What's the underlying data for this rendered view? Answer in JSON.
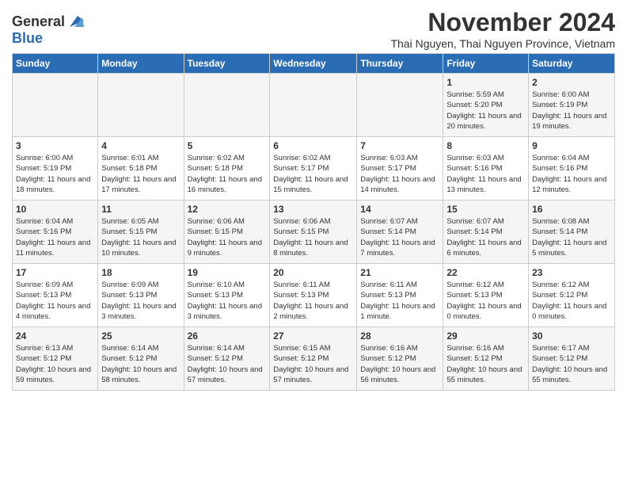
{
  "header": {
    "logo_general": "General",
    "logo_blue": "Blue",
    "month_year": "November 2024",
    "location": "Thai Nguyen, Thai Nguyen Province, Vietnam"
  },
  "calendar": {
    "days_of_week": [
      "Sunday",
      "Monday",
      "Tuesday",
      "Wednesday",
      "Thursday",
      "Friday",
      "Saturday"
    ],
    "weeks": [
      [
        {
          "day": "",
          "info": ""
        },
        {
          "day": "",
          "info": ""
        },
        {
          "day": "",
          "info": ""
        },
        {
          "day": "",
          "info": ""
        },
        {
          "day": "",
          "info": ""
        },
        {
          "day": "1",
          "info": "Sunrise: 5:59 AM\nSunset: 5:20 PM\nDaylight: 11 hours and 20 minutes."
        },
        {
          "day": "2",
          "info": "Sunrise: 6:00 AM\nSunset: 5:19 PM\nDaylight: 11 hours and 19 minutes."
        }
      ],
      [
        {
          "day": "3",
          "info": "Sunrise: 6:00 AM\nSunset: 5:19 PM\nDaylight: 11 hours and 18 minutes."
        },
        {
          "day": "4",
          "info": "Sunrise: 6:01 AM\nSunset: 5:18 PM\nDaylight: 11 hours and 17 minutes."
        },
        {
          "day": "5",
          "info": "Sunrise: 6:02 AM\nSunset: 5:18 PM\nDaylight: 11 hours and 16 minutes."
        },
        {
          "day": "6",
          "info": "Sunrise: 6:02 AM\nSunset: 5:17 PM\nDaylight: 11 hours and 15 minutes."
        },
        {
          "day": "7",
          "info": "Sunrise: 6:03 AM\nSunset: 5:17 PM\nDaylight: 11 hours and 14 minutes."
        },
        {
          "day": "8",
          "info": "Sunrise: 6:03 AM\nSunset: 5:16 PM\nDaylight: 11 hours and 13 minutes."
        },
        {
          "day": "9",
          "info": "Sunrise: 6:04 AM\nSunset: 5:16 PM\nDaylight: 11 hours and 12 minutes."
        }
      ],
      [
        {
          "day": "10",
          "info": "Sunrise: 6:04 AM\nSunset: 5:16 PM\nDaylight: 11 hours and 11 minutes."
        },
        {
          "day": "11",
          "info": "Sunrise: 6:05 AM\nSunset: 5:15 PM\nDaylight: 11 hours and 10 minutes."
        },
        {
          "day": "12",
          "info": "Sunrise: 6:06 AM\nSunset: 5:15 PM\nDaylight: 11 hours and 9 minutes."
        },
        {
          "day": "13",
          "info": "Sunrise: 6:06 AM\nSunset: 5:15 PM\nDaylight: 11 hours and 8 minutes."
        },
        {
          "day": "14",
          "info": "Sunrise: 6:07 AM\nSunset: 5:14 PM\nDaylight: 11 hours and 7 minutes."
        },
        {
          "day": "15",
          "info": "Sunrise: 6:07 AM\nSunset: 5:14 PM\nDaylight: 11 hours and 6 minutes."
        },
        {
          "day": "16",
          "info": "Sunrise: 6:08 AM\nSunset: 5:14 PM\nDaylight: 11 hours and 5 minutes."
        }
      ],
      [
        {
          "day": "17",
          "info": "Sunrise: 6:09 AM\nSunset: 5:13 PM\nDaylight: 11 hours and 4 minutes."
        },
        {
          "day": "18",
          "info": "Sunrise: 6:09 AM\nSunset: 5:13 PM\nDaylight: 11 hours and 3 minutes."
        },
        {
          "day": "19",
          "info": "Sunrise: 6:10 AM\nSunset: 5:13 PM\nDaylight: 11 hours and 3 minutes."
        },
        {
          "day": "20",
          "info": "Sunrise: 6:11 AM\nSunset: 5:13 PM\nDaylight: 11 hours and 2 minutes."
        },
        {
          "day": "21",
          "info": "Sunrise: 6:11 AM\nSunset: 5:13 PM\nDaylight: 11 hours and 1 minute."
        },
        {
          "day": "22",
          "info": "Sunrise: 6:12 AM\nSunset: 5:13 PM\nDaylight: 11 hours and 0 minutes."
        },
        {
          "day": "23",
          "info": "Sunrise: 6:12 AM\nSunset: 5:12 PM\nDaylight: 11 hours and 0 minutes."
        }
      ],
      [
        {
          "day": "24",
          "info": "Sunrise: 6:13 AM\nSunset: 5:12 PM\nDaylight: 10 hours and 59 minutes."
        },
        {
          "day": "25",
          "info": "Sunrise: 6:14 AM\nSunset: 5:12 PM\nDaylight: 10 hours and 58 minutes."
        },
        {
          "day": "26",
          "info": "Sunrise: 6:14 AM\nSunset: 5:12 PM\nDaylight: 10 hours and 57 minutes."
        },
        {
          "day": "27",
          "info": "Sunrise: 6:15 AM\nSunset: 5:12 PM\nDaylight: 10 hours and 57 minutes."
        },
        {
          "day": "28",
          "info": "Sunrise: 6:16 AM\nSunset: 5:12 PM\nDaylight: 10 hours and 56 minutes."
        },
        {
          "day": "29",
          "info": "Sunrise: 6:16 AM\nSunset: 5:12 PM\nDaylight: 10 hours and 55 minutes."
        },
        {
          "day": "30",
          "info": "Sunrise: 6:17 AM\nSunset: 5:12 PM\nDaylight: 10 hours and 55 minutes."
        }
      ]
    ]
  }
}
